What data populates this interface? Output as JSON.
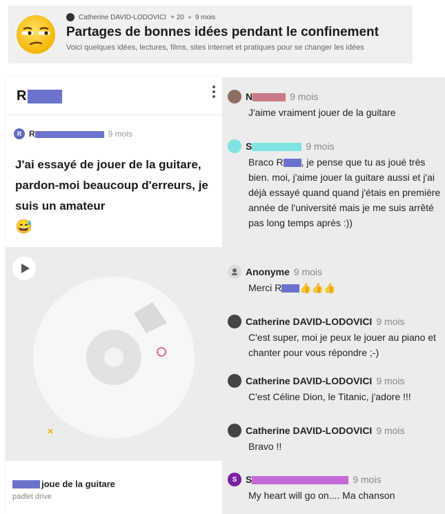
{
  "header": {
    "author": "Catherine DAVID-LODOVICI",
    "likes": "+ 20",
    "time": "9 mois",
    "title": "Partages de bonnes idées pendant le confinement",
    "subtitle": "Voici quelques idées, lectures, films, sites internet et pratiques pour se changer les idées"
  },
  "post": {
    "title_initial": "R",
    "author_initial": "R",
    "author_name_start": "R",
    "time": "9 mois",
    "body": "J'ai essayé de jouer de la guitare, pardon-moi beaucoup d'erreurs, je suis un amateur",
    "emoji": "😅",
    "media_caption": "joue de la guitare",
    "media_source": "padlet drive"
  },
  "comments": [
    {
      "author": "N",
      "time": "9 mois",
      "text": "J'aime vraiment jouer de la guitare"
    },
    {
      "author": "S",
      "time": "9 mois",
      "text_a": "Braco R",
      "text_b": ", je pense que tu as joué très bien. moi, j'aime jouer la guitare aussi et j'ai déjà essayé quand quand j'étais en première année de l'université mais je me suis arrêté pas long temps après :))"
    },
    {
      "author": "Anonyme",
      "time": "9 mois",
      "text_a": "Merci R",
      "thumbs": "👍👍👍"
    },
    {
      "author": "Catherine DAVID-LODOVICI",
      "time": "9 mois",
      "text": "C'est super, moi je peux le jouer au piano et chanter pour vous répondre ;-)"
    },
    {
      "author": "Catherine DAVID-LODOVICI",
      "time": "9 mois",
      "text": "C'est Céline Dion, le Titanic, j'adore !!!"
    },
    {
      "author": "Catherine DAVID-LODOVICI",
      "time": "9 mois",
      "text": "Bravo !!"
    },
    {
      "author": "S",
      "avatar_letter": "S",
      "time": "9 mois",
      "text": "My heart will go on.... Ma chanson"
    }
  ],
  "colors": {
    "redaction_blue": "#6b72cc",
    "redaction_cyan": "#7fe3e3",
    "redaction_pink": "#c97a86",
    "redaction_purple": "#c46ad8",
    "avatar_purple": "#7b1fa2"
  }
}
